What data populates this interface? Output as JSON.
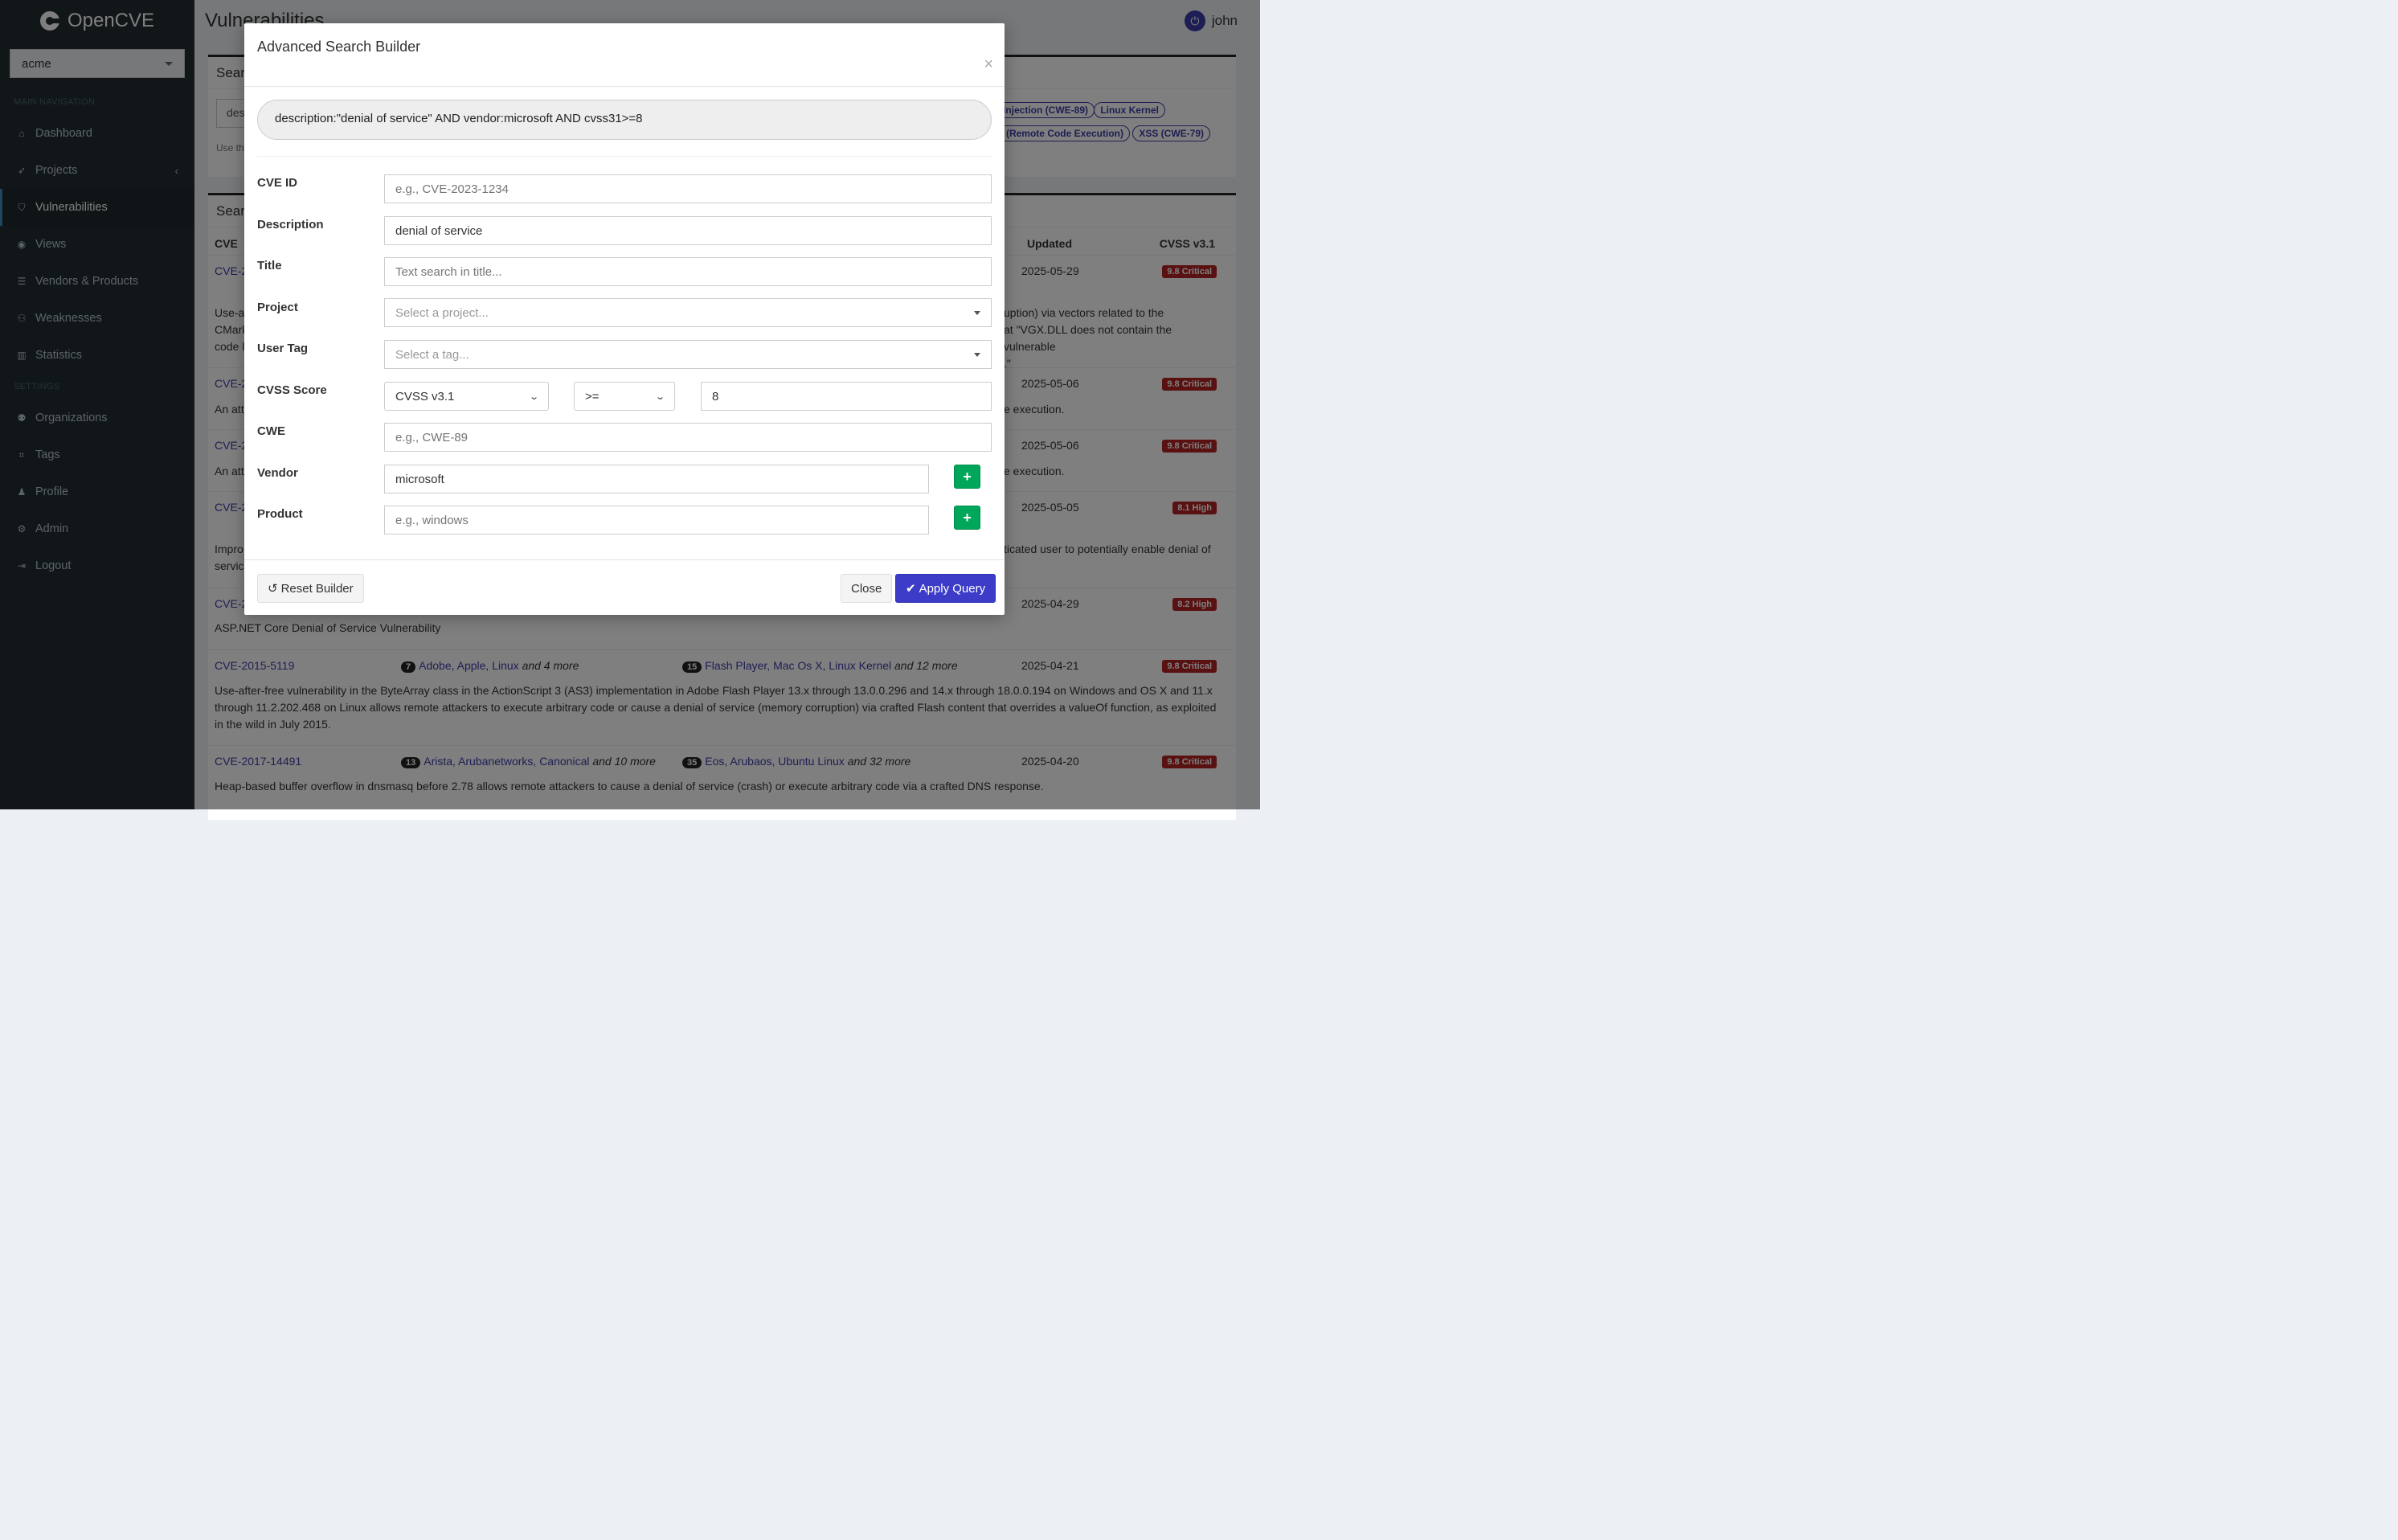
{
  "app": {
    "brand": "OpenCVE",
    "org": "acme"
  },
  "sidebar": {
    "main_header": "MAIN NAVIGATION",
    "settings_header": "SETTINGS",
    "items": [
      {
        "label": "Dashboard",
        "icon": "home-icon",
        "glyph": "⌂"
      },
      {
        "label": "Projects",
        "icon": "rocket-icon",
        "glyph": "➶"
      },
      {
        "label": "Vulnerabilities",
        "icon": "shield-icon",
        "glyph": "⛉"
      },
      {
        "label": "Views",
        "icon": "eye-icon",
        "glyph": "◉"
      },
      {
        "label": "Vendors & Products",
        "icon": "list-icon",
        "glyph": "☰"
      },
      {
        "label": "Weaknesses",
        "icon": "sitemap-icon",
        "glyph": "⚇"
      },
      {
        "label": "Statistics",
        "icon": "bar-chart-icon",
        "glyph": "▥"
      }
    ],
    "settings": [
      {
        "label": "Organizations",
        "icon": "users-icon",
        "glyph": "⚉"
      },
      {
        "label": "Tags",
        "icon": "tags-icon",
        "glyph": "⌗"
      },
      {
        "label": "Profile",
        "icon": "user-icon",
        "glyph": "♟"
      },
      {
        "label": "Admin",
        "icon": "gear-icon",
        "glyph": "⚙"
      },
      {
        "label": "Logout",
        "icon": "sign-out-icon",
        "glyph": "⇥"
      }
    ]
  },
  "header": {
    "title": "Vulnerabilities",
    "username": "john"
  },
  "search_box": {
    "title": "Searc",
    "input_value": "des",
    "help": "Use th",
    "chips": [
      "Injection (CWE-89)",
      "Linux Kernel",
      "CE (Remote Code Execution)",
      "XSS (CWE-79)"
    ]
  },
  "results": {
    "title": "Searc",
    "columns": {
      "cve": "CVE",
      "updated": "Updated",
      "cvss": "CVSS v3.1"
    },
    "rows": [
      {
        "cve": "CVE-20",
        "updated": "2025-05-29",
        "score": "9.8 Critical",
        "desc_left": "Use-af\nCMark\ncode l",
        "desc_right": "uption) via vectors related to the\nat \"VGX.DLL does not contain the vulnerable\n.\""
      },
      {
        "cve": "CVE-20",
        "updated": "2025-05-06",
        "score": "9.8 Critical",
        "desc_left": "An att",
        "desc_right": "e execution."
      },
      {
        "cve": "CVE-20",
        "updated": "2025-05-06",
        "score": "9.8 Critical",
        "desc_left": "An att",
        "desc_right": "e execution."
      },
      {
        "cve": "CVE-20",
        "updated": "2025-05-05",
        "score": "8.1 High",
        "desc_left": "Impro\nservic",
        "desc_right": "ticated user to potentially enable denial of"
      },
      {
        "cve": "CVE-20",
        "updated": "2025-04-29",
        "score": "8.2 High",
        "desc": "ASP.NET Core Denial of Service Vulnerability"
      },
      {
        "cve": "CVE-2015-5119",
        "updated": "2025-04-21",
        "score": "9.8 Critical",
        "vendor_count": "7",
        "vendors": "Adobe, Apple, Linux",
        "vendors_more": "and 4 more",
        "product_count": "15",
        "products": "Flash Player, Mac Os X, Linux Kernel",
        "products_more": "and 12 more",
        "desc": "Use-after-free vulnerability in the ByteArray class in the ActionScript 3 (AS3) implementation in Adobe Flash Player 13.x through 13.0.0.296 and 14.x through 18.0.0.194 on Windows and OS X and 11.x through 11.2.202.468 on Linux allows remote attackers to execute arbitrary code or cause a denial of service (memory corruption) via crafted Flash content that overrides a valueOf function, as exploited in the wild in July 2015."
      },
      {
        "cve": "CVE-2017-14491",
        "updated": "2025-04-20",
        "score": "9.8 Critical",
        "vendor_count": "13",
        "vendors": "Arista, Arubanetworks, Canonical",
        "vendors_more": "and 10 more",
        "product_count": "35",
        "products": "Eos, Arubaos, Ubuntu Linux",
        "products_more": "and 32 more",
        "desc": "Heap-based buffer overflow in dnsmasq before 2.78 allows remote attackers to cause a denial of service (crash) or execute arbitrary code via a crafted DNS response."
      }
    ]
  },
  "modal": {
    "title": "Advanced Search Builder",
    "close_glyph": "×",
    "query": "description:\"denial of service\" AND vendor:microsoft AND cvss31>=8",
    "fields": {
      "cve_id": {
        "label": "CVE ID",
        "value": "",
        "placeholder": "e.g., CVE-2023-1234"
      },
      "description": {
        "label": "Description",
        "value": "denial of service",
        "placeholder": ""
      },
      "title": {
        "label": "Title",
        "value": "",
        "placeholder": "Text search in title..."
      },
      "project": {
        "label": "Project",
        "placeholder": "Select a project..."
      },
      "user_tag": {
        "label": "User Tag",
        "placeholder": "Select a tag..."
      },
      "cvss": {
        "label": "CVSS Score",
        "version": "CVSS v3.1",
        "operator": ">=",
        "value": "8"
      },
      "cwe": {
        "label": "CWE",
        "value": "",
        "placeholder": "e.g., CWE-89"
      },
      "vendor": {
        "label": "Vendor",
        "value": "microsoft",
        "placeholder": ""
      },
      "product": {
        "label": "Product",
        "value": "",
        "placeholder": "e.g., windows"
      }
    },
    "add_glyph": "+",
    "buttons": {
      "reset": "Reset Builder",
      "reset_glyph": "↺",
      "close": "Close",
      "apply": "Apply Query",
      "apply_glyph": "✔"
    }
  },
  "colors": {
    "accent": "#3c3cc8",
    "success": "#00a65a",
    "critical": "#b22222",
    "sidebar": "#222d32"
  }
}
